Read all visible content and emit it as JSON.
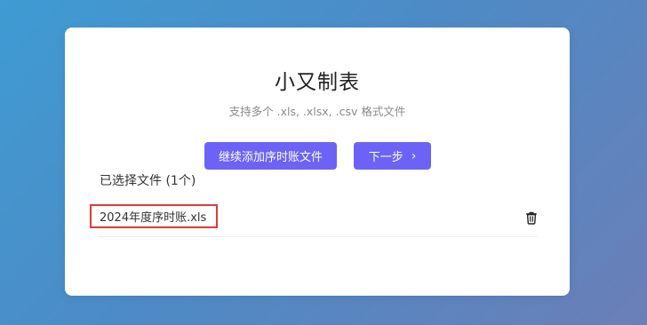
{
  "app": {
    "title": "小又制表",
    "subtitle": "支持多个 .xls, .xlsx, .csv 格式文件"
  },
  "actions": {
    "add_label": "继续添加序时账文件",
    "next_label": "下一步",
    "next_chevron": "›"
  },
  "files": {
    "selected_label": "已选择文件 (1个)",
    "items": [
      {
        "name": "2024年度序时账.xls",
        "delete_icon": "trash-icon"
      }
    ]
  },
  "colors": {
    "primary": "#6c63f6",
    "highlight_border": "#e0393c",
    "background_start": "#3f9bd3",
    "background_end": "#6b7fb8"
  }
}
